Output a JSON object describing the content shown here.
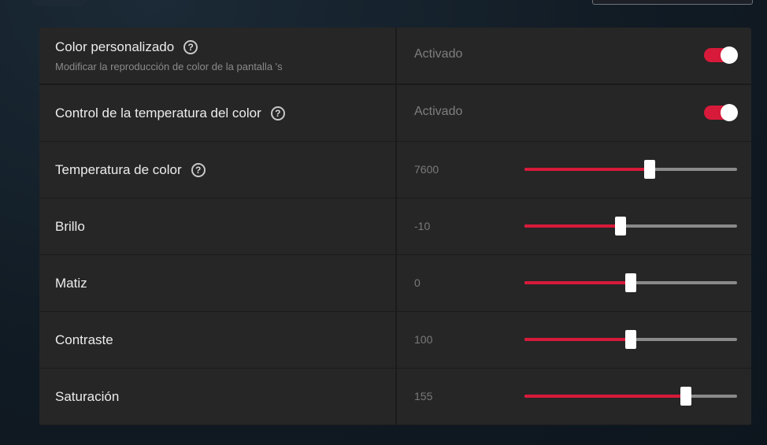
{
  "settings": {
    "custom_color": {
      "title": "Color personalizado",
      "subtitle": "Modificar la reproducción de color de la pantalla 's",
      "status": "Activado",
      "enabled": true
    },
    "color_temp_control": {
      "title": "Control de la temperatura del color",
      "status": "Activado",
      "enabled": true
    },
    "color_temperature": {
      "title": "Temperatura de color",
      "value": "7600",
      "fraction": 0.59
    },
    "brightness": {
      "title": "Brillo",
      "value": "-10",
      "fraction": 0.45
    },
    "hue": {
      "title": "Matiz",
      "value": "0",
      "fraction": 0.5
    },
    "contrast": {
      "title": "Contraste",
      "value": "100",
      "fraction": 0.5
    },
    "saturation": {
      "title": "Saturación",
      "value": "155",
      "fraction": 0.76
    }
  },
  "colors": {
    "accent": "#d71a3a",
    "row_background": "#262626",
    "panel_background": "#1b1b1b"
  },
  "icons": {
    "help": "question-circle-icon"
  }
}
